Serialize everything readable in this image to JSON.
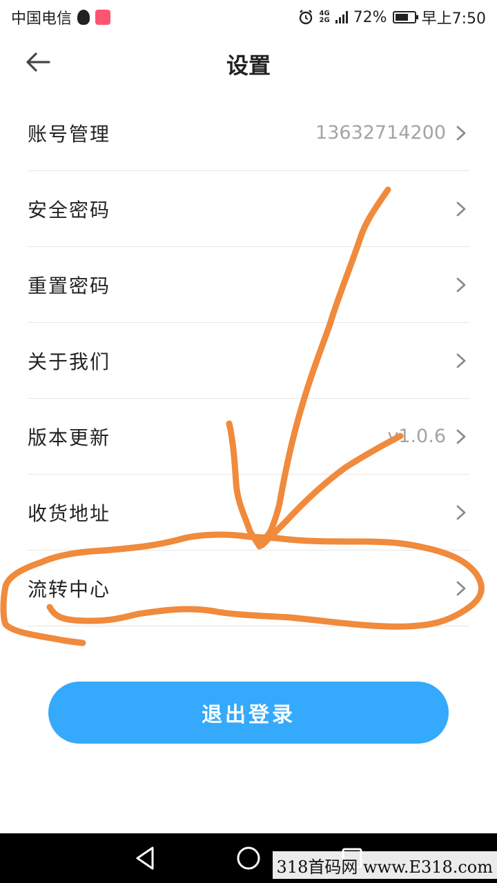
{
  "status_bar": {
    "carrier": "中国电信",
    "network": "4G",
    "network_sub": "2G",
    "battery": "72%",
    "battery_level": 0.72,
    "time": "早上7:50"
  },
  "header": {
    "title": "设置"
  },
  "settings": [
    {
      "label": "账号管理",
      "value": "13632714200"
    },
    {
      "label": "安全密码",
      "value": ""
    },
    {
      "label": "重置密码",
      "value": ""
    },
    {
      "label": "关于我们",
      "value": ""
    },
    {
      "label": "版本更新",
      "value": "v1.0.6"
    },
    {
      "label": "收货地址",
      "value": ""
    },
    {
      "label": "流转中心",
      "value": ""
    }
  ],
  "logout_label": "退出登录",
  "watermark": "318首码网 www.E318.com",
  "colors": {
    "accent": "#35a9fb",
    "annotation": "#f08a3c",
    "value_text": "#a3a3a3"
  }
}
